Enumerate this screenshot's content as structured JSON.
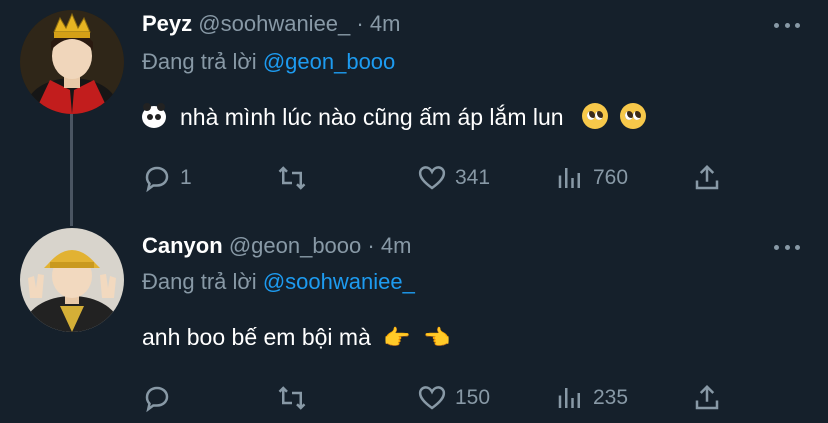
{
  "tweets": [
    {
      "name": "Peyz",
      "handle": "@soohwaniee_",
      "dot": "·",
      "time": "4m",
      "reply_prefix": "Đang trả lời",
      "reply_to": "@geon_booo",
      "text": "nhà mình lúc nào cũng ấm áp lắm lun",
      "emojis_before": [
        "panda-emoji"
      ],
      "emojis_after": [
        "pleading-face-emoji",
        "pleading-face-emoji"
      ],
      "actions": {
        "reply_count": "1",
        "retweet_count": "",
        "like_count": "341",
        "views_count": "760"
      }
    },
    {
      "name": "Canyon",
      "handle": "@geon_booo",
      "dot": "·",
      "time": "4m",
      "reply_prefix": "Đang trả lời",
      "reply_to": "@soohwaniee_",
      "text": "anh boo bế em bội mà",
      "emojis_after": [
        "pointing-right-hand-emoji",
        "pointing-left-hand-emoji"
      ],
      "actions": {
        "reply_count": "",
        "retweet_count": "",
        "like_count": "150",
        "views_count": "235"
      }
    }
  ],
  "colors": {
    "background": "#15202b",
    "secondary_text": "#8899a6",
    "mention": "#1d9bf0",
    "thread_line": "#4a5562"
  }
}
